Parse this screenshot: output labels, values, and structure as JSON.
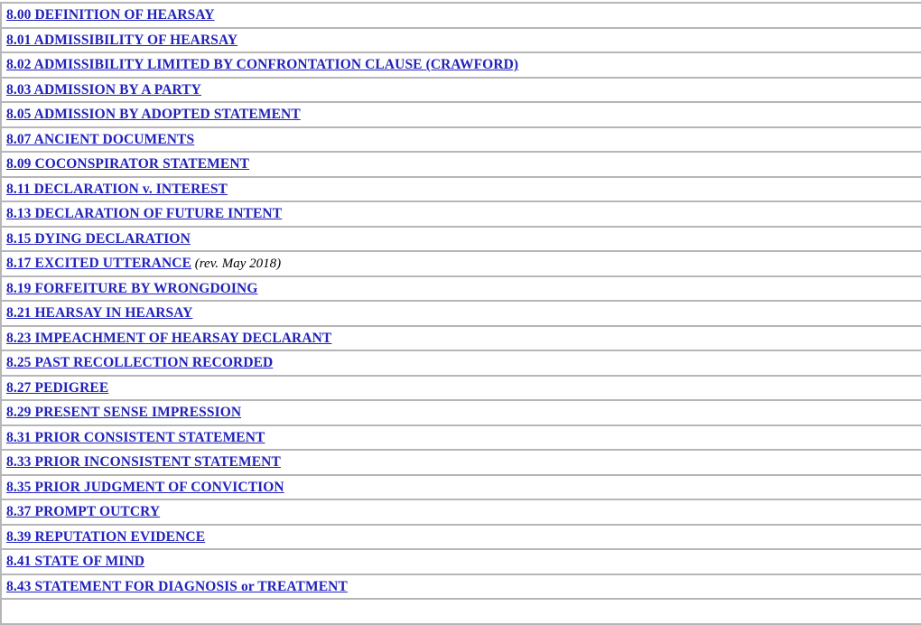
{
  "page": {
    "document_title": "Hearsay Instructions Index",
    "link_color": "#2222bb",
    "separator_color": "#b6b6b6",
    "background_color": "#ffffff",
    "note_color": "#000000"
  },
  "index": {
    "rows": [
      {
        "label": "8.00 DEFINITION OF HEARSAY",
        "note": ""
      },
      {
        "label": "8.01 ADMISSIBILITY OF HEARSAY",
        "note": ""
      },
      {
        "label": "8.02 ADMISSIBILITY LIMITED BY CONFRONTATION CLAUSE (CRAWFORD)",
        "note": ""
      },
      {
        "label": "8.03 ADMISSION BY A PARTY",
        "note": ""
      },
      {
        "label": "8.05 ADMISSION BY ADOPTED STATEMENT",
        "note": ""
      },
      {
        "label": "8.07 ANCIENT DOCUMENTS",
        "note": ""
      },
      {
        "label": "8.09 COCONSPIRATOR STATEMENT",
        "note": ""
      },
      {
        "label": "8.11 DECLARATION v. INTEREST",
        "note": ""
      },
      {
        "label": "8.13 DECLARATION OF FUTURE INTENT",
        "note": ""
      },
      {
        "label": "8.15 DYING DECLARATION",
        "note": ""
      },
      {
        "label": "8.17 EXCITED UTTERANCE",
        "note": " (rev. May 2018)"
      },
      {
        "label": "8.19 FORFEITURE BY WRONGDOING",
        "note": ""
      },
      {
        "label": "8.21 HEARSAY IN HEARSAY",
        "note": ""
      },
      {
        "label": "8.23 IMPEACHMENT OF HEARSAY DECLARANT",
        "note": ""
      },
      {
        "label": "8.25 PAST RECOLLECTION RECORDED",
        "note": ""
      },
      {
        "label": "8.27 PEDIGREE",
        "note": ""
      },
      {
        "label": "8.29 PRESENT SENSE IMPRESSION",
        "note": ""
      },
      {
        "label": "8.31 PRIOR CONSISTENT STATEMENT",
        "note": ""
      },
      {
        "label": "8.33 PRIOR INCONSISTENT STATEMENT",
        "note": ""
      },
      {
        "label": "8.35 PRIOR JUDGMENT OF CONVICTION",
        "note": ""
      },
      {
        "label": "8.37 PROMPT OUTCRY",
        "note": ""
      },
      {
        "label": "8.39 REPUTATION EVIDENCE",
        "note": ""
      },
      {
        "label": "8.41 STATE OF MIND",
        "note": ""
      },
      {
        "label": "8.43 STATEMENT FOR DIAGNOSIS or TREATMENT",
        "note": ""
      }
    ]
  }
}
